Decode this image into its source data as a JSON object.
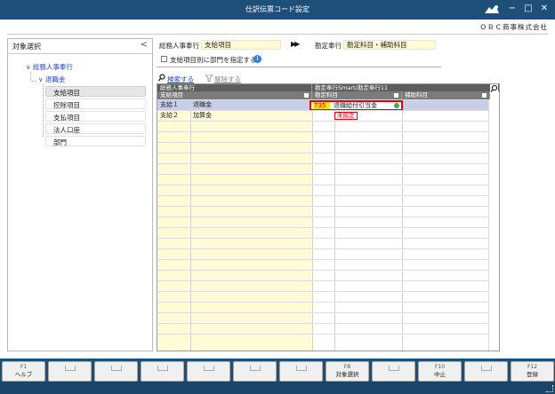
{
  "window": {
    "title": "仕訳伝票コード設定",
    "controls": {
      "minimize": "−",
      "maximize": "□",
      "close": "✕"
    },
    "logo_icon": "logo-icon"
  },
  "header": {
    "company": "ＯＢＣ商事株式会社"
  },
  "left_panel": {
    "title": "対象選択",
    "collapse": "<",
    "tree": {
      "root": "総務人事奉行",
      "child": "退職金",
      "items": [
        "支給項目",
        "控除項目",
        "支払項目",
        "法人口座",
        "部門"
      ],
      "selected_index": 0
    }
  },
  "form": {
    "source_label": "総務人事奉行",
    "source_value": "支給項目",
    "arrows": "▶▶",
    "target_label": "勘定奉行",
    "target_value": "勘定科目・補助科目",
    "checkbox_label": "支給項目別に部門を指定する",
    "checkbox_checked": false,
    "info_icon": "i"
  },
  "toolbar": {
    "search_label": "検索する",
    "clear_label": "解除する"
  },
  "grid": {
    "group_left": "総務人事奉行",
    "group_right": "勘定奉行Smart/勘定奉行11",
    "columns": {
      "item": "支給項目",
      "account": "勘定科目",
      "sub_account": "補助科目"
    },
    "rows": [
      {
        "code": "支給１",
        "name": "退職金",
        "account_code": "735",
        "account_name": "退職給付引当金",
        "sub_account": ""
      },
      {
        "code": "支給２",
        "name": "加算金",
        "account_code": "",
        "account_name": "",
        "account_status": "未指定",
        "sub_account": ""
      }
    ],
    "empty_rows": 20,
    "colors": {
      "editable": "#fffbd7",
      "selected": "#c7cfe8",
      "highlight": "#e0000f",
      "code_fill": "#ffe600"
    }
  },
  "fkeys": [
    {
      "key": "F1",
      "label": "ヘルプ"
    },
    {
      "key": "",
      "label": ""
    },
    {
      "key": "",
      "label": ""
    },
    {
      "key": "",
      "label": ""
    },
    {
      "key": "",
      "label": ""
    },
    {
      "key": "",
      "label": ""
    },
    {
      "key": "",
      "label": ""
    },
    {
      "key": "F8",
      "label": "対象選択"
    },
    {
      "key": "",
      "label": ""
    },
    {
      "key": "F10",
      "label": "中止"
    },
    {
      "key": "",
      "label": ""
    },
    {
      "key": "F12",
      "label": "登録"
    }
  ],
  "theme": {
    "titlebar": "#1e4f78",
    "link": "#2244cc"
  }
}
